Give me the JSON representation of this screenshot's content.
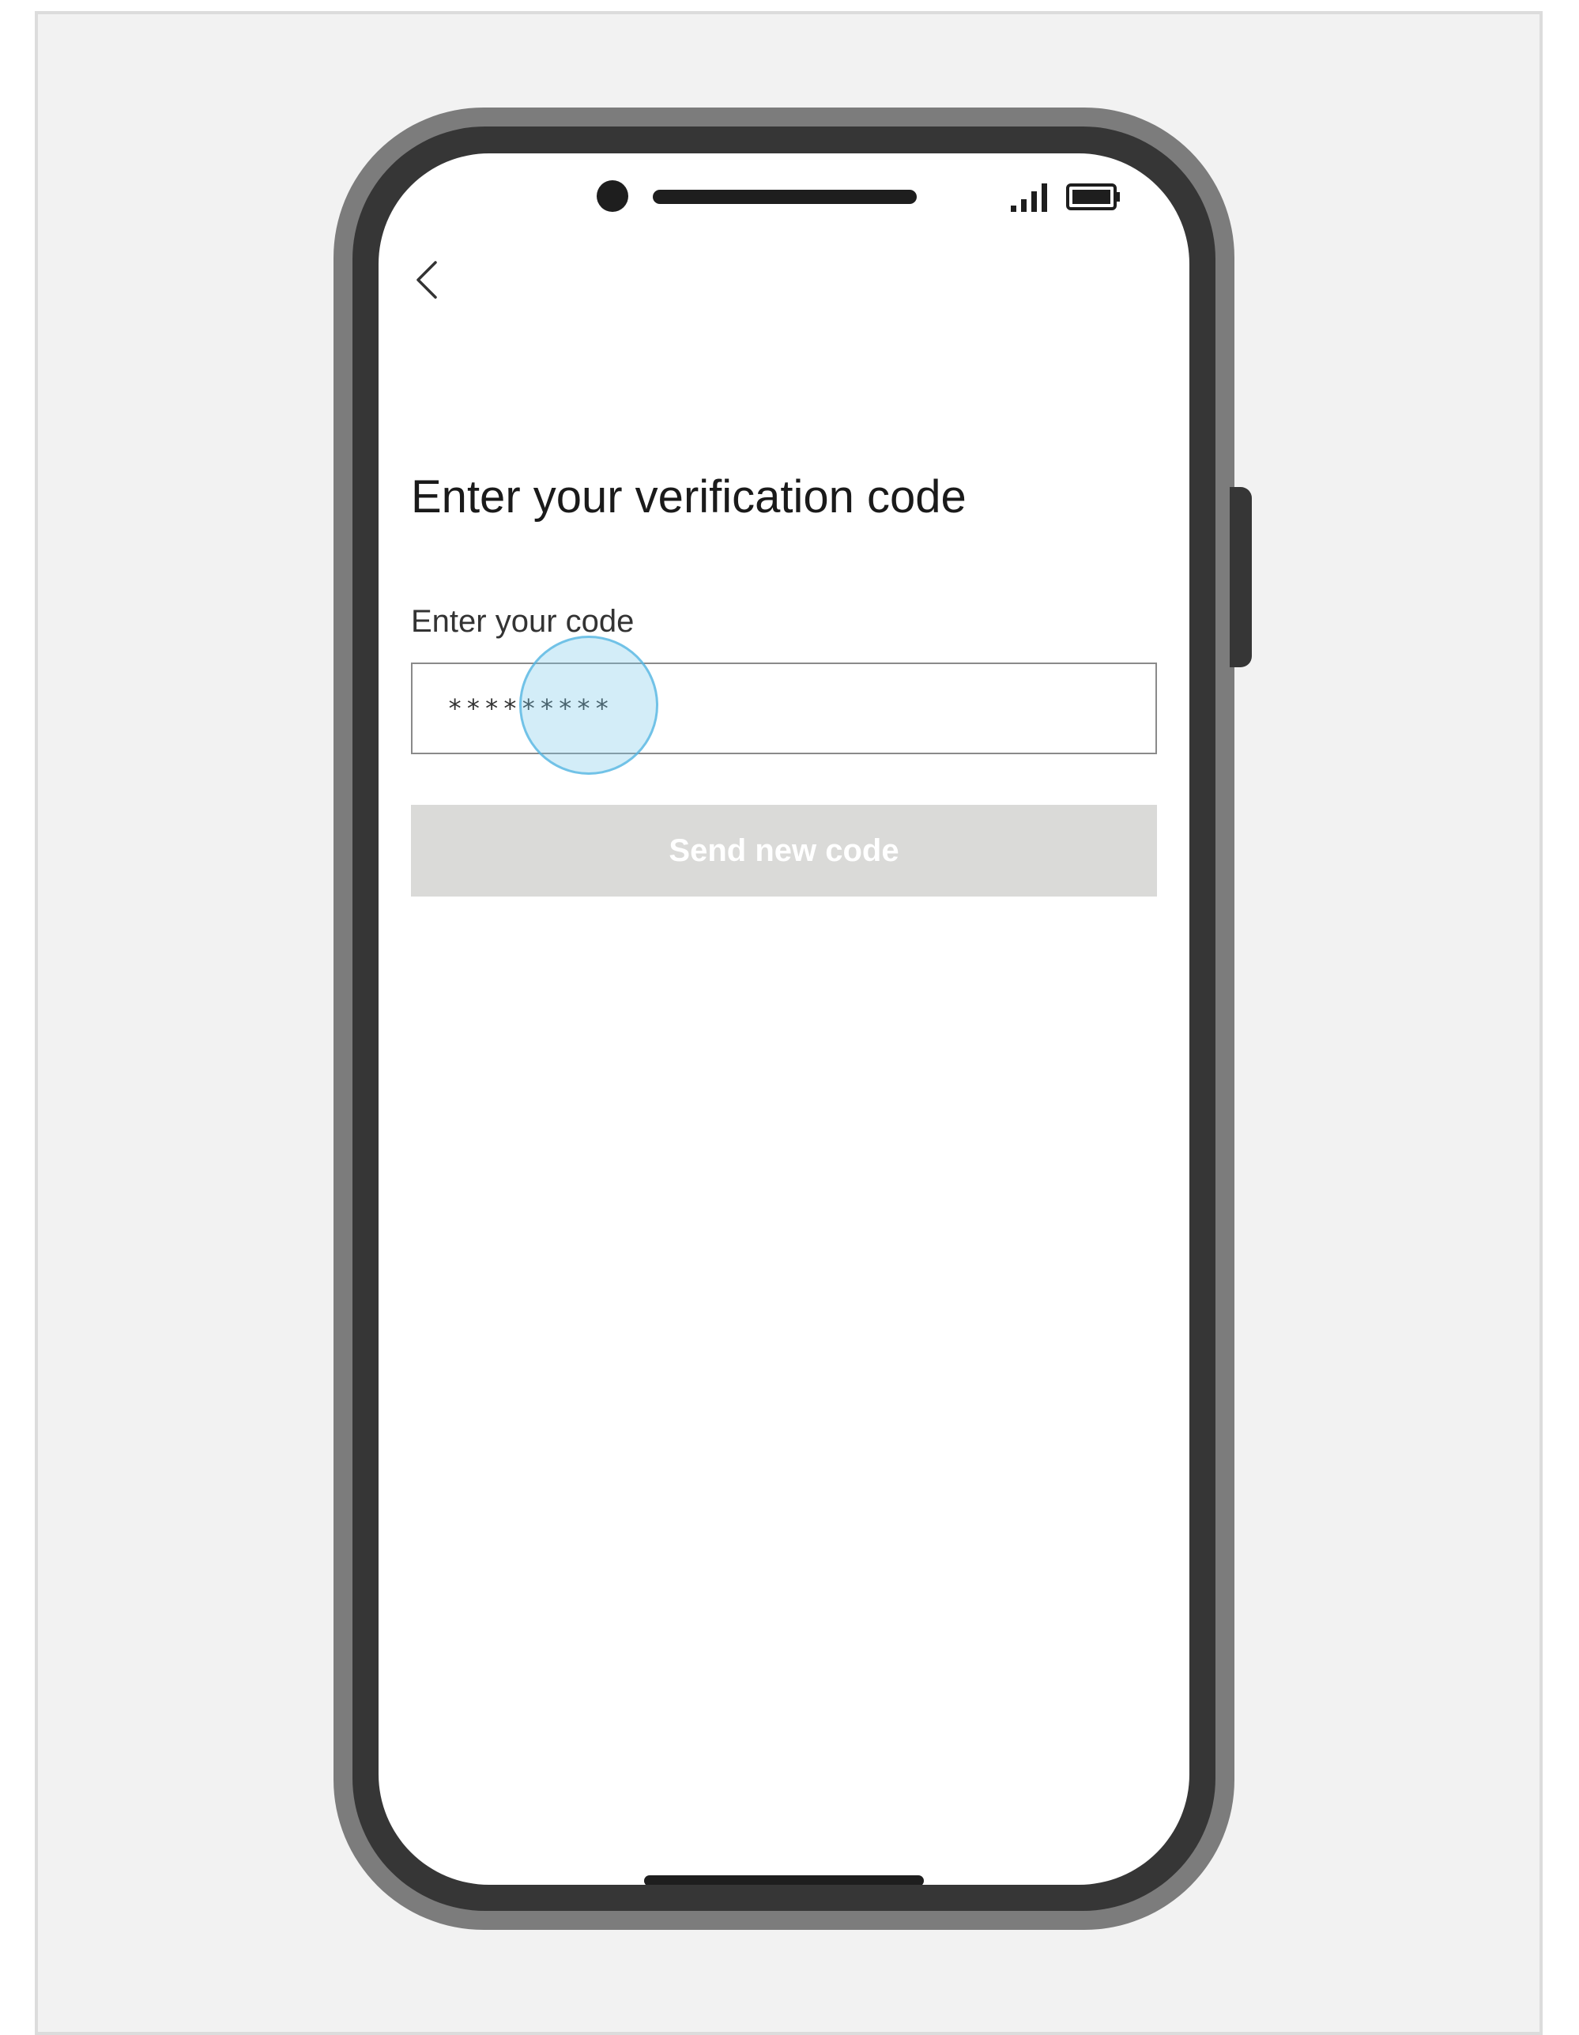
{
  "screen": {
    "title": "Enter your verification code",
    "code_field": {
      "label": "Enter your code",
      "value": "*********"
    },
    "send_new_code_label": "Send new code",
    "send_new_code_enabled": false
  },
  "icons": {
    "back": "chevron-left-icon",
    "signal": "signal-icon",
    "battery": "battery-icon"
  },
  "colors": {
    "disabled_button_bg": "#dadad8",
    "tap_highlight": "#78c8eb",
    "phone_body": "#363636"
  }
}
